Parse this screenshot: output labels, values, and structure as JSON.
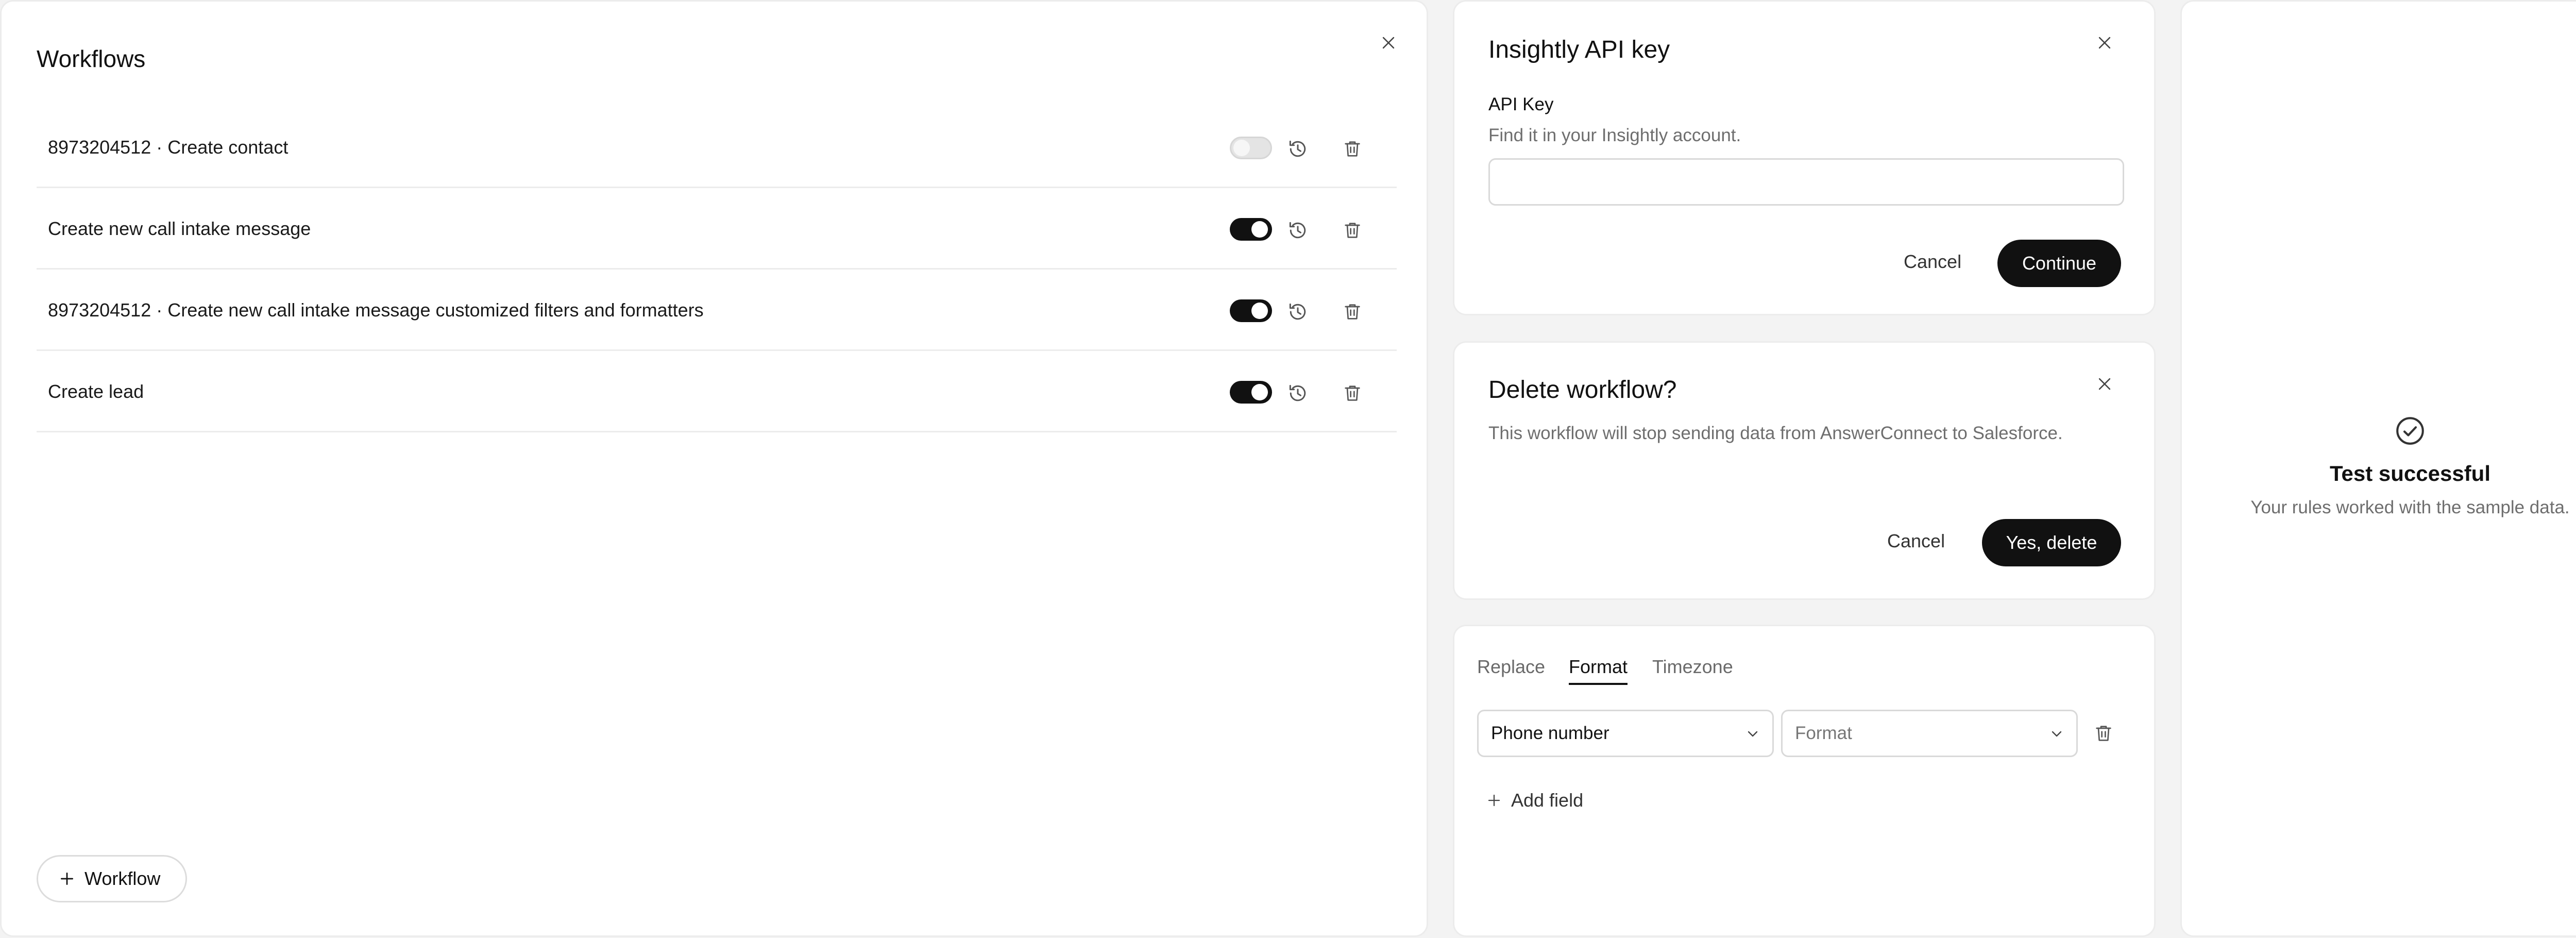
{
  "workflows": {
    "title": "Workflows",
    "rows": [
      {
        "label": "8973204512 · Create contact",
        "enabled": false
      },
      {
        "label": "Create new call intake message",
        "enabled": true
      },
      {
        "label": "8973204512 · Create new call intake message customized filters and formatters",
        "enabled": true
      },
      {
        "label": "Create lead",
        "enabled": true
      }
    ],
    "add_button": "Workflow"
  },
  "api_key_dialog": {
    "title": "Insightly API key",
    "field_label": "API Key",
    "field_hint": "Find it in your Insightly account.",
    "field_value": "",
    "cancel": "Cancel",
    "continue": "Continue"
  },
  "delete_dialog": {
    "title": "Delete workflow?",
    "description": "This workflow will stop sending data from AnswerConnect to Salesforce.",
    "cancel": "Cancel",
    "confirm": "Yes, delete"
  },
  "formatter": {
    "tabs": [
      {
        "label": "Replace",
        "active": false
      },
      {
        "label": "Format",
        "active": true
      },
      {
        "label": "Timezone",
        "active": false
      }
    ],
    "field_select": "Phone number",
    "format_select_placeholder": "Format",
    "add_field": "Add field"
  },
  "test_result": {
    "title": "Test successful",
    "message": "Your rules worked with the sample data."
  },
  "colors": {
    "background": "#f3f3f3",
    "panel": "#ffffff",
    "primary": "#111111",
    "muted": "#6e6e6e",
    "border": "#ececec"
  },
  "icons": [
    "close-icon",
    "history-icon",
    "trash-icon",
    "plus-icon",
    "chevron-down-icon",
    "check-circle-icon"
  ]
}
